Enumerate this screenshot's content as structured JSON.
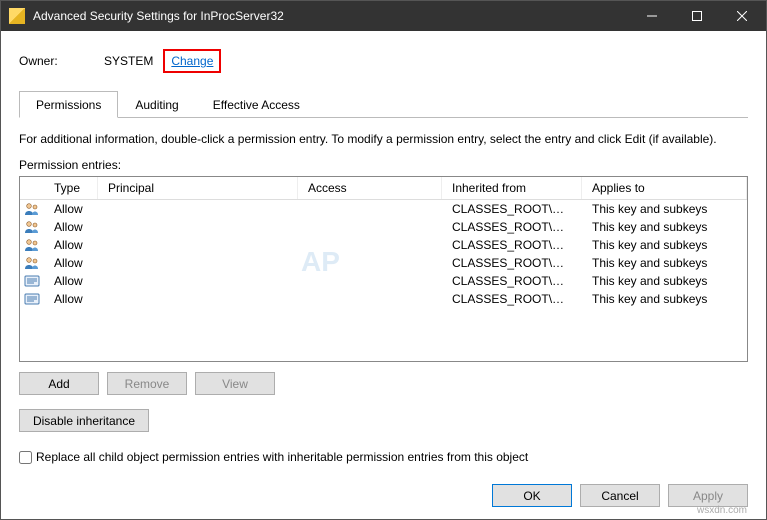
{
  "title": "Advanced Security Settings for InProcServer32",
  "owner": {
    "label": "Owner:",
    "value": "SYSTEM",
    "change_label": "Change"
  },
  "tabs": [
    {
      "label": "Permissions",
      "active": true
    },
    {
      "label": "Auditing",
      "active": false
    },
    {
      "label": "Effective Access",
      "active": false
    }
  ],
  "info_text": "For additional information, double-click a permission entry. To modify a permission entry, select the entry and click Edit (if available).",
  "entries_label": "Permission entries:",
  "columns": {
    "type": "Type",
    "principal": "Principal",
    "access": "Access",
    "inherited": "Inherited from",
    "applies": "Applies to"
  },
  "rows": [
    {
      "icon": "users",
      "type": "Allow",
      "principal": "",
      "access": "",
      "inherited": "CLASSES_ROOT\\CLSID...",
      "applies": "This key and subkeys"
    },
    {
      "icon": "users",
      "type": "Allow",
      "principal": "",
      "access": "",
      "inherited": "CLASSES_ROOT\\CLSID...",
      "applies": "This key and subkeys"
    },
    {
      "icon": "users",
      "type": "Allow",
      "principal": "",
      "access": "",
      "inherited": "CLASSES_ROOT\\CLSID...",
      "applies": "This key and subkeys"
    },
    {
      "icon": "users",
      "type": "Allow",
      "principal": "",
      "access": "",
      "inherited": "CLASSES_ROOT\\CLSID...",
      "applies": "This key and subkeys"
    },
    {
      "icon": "reg",
      "type": "Allow",
      "principal": "",
      "access": "",
      "inherited": "CLASSES_ROOT\\CLSID...",
      "applies": "This key and subkeys"
    },
    {
      "icon": "reg",
      "type": "Allow",
      "principal": "",
      "access": "",
      "inherited": "CLASSES_ROOT\\CLSID...",
      "applies": "This key and subkeys"
    }
  ],
  "buttons": {
    "add": "Add",
    "remove": "Remove",
    "view": "View",
    "disable": "Disable inheritance",
    "ok": "OK",
    "cancel": "Cancel",
    "apply": "Apply"
  },
  "checkbox_label": "Replace all child object permission entries with inheritable permission entries from this object",
  "footnote": "wsxdn.com"
}
